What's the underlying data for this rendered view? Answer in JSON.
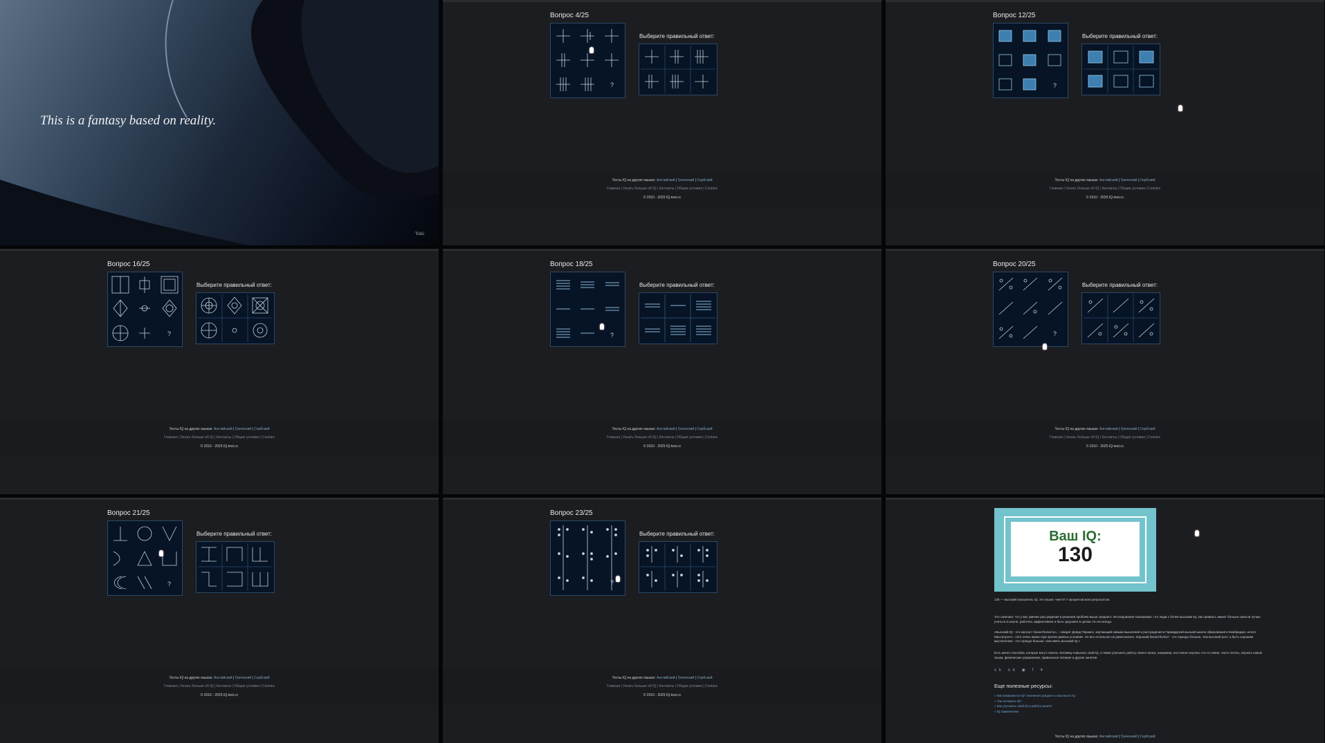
{
  "cover": {
    "quote": "This is a fantasy based on reality.",
    "signature": "Yuki"
  },
  "choose_label": "Выберите правильный ответ:",
  "footer": {
    "languages_prefix": "Тесты IQ на других языках:",
    "languages": [
      "Английский",
      "Греческий",
      "Сербский"
    ],
    "links": [
      "Главная",
      "Узнать больше об IQ",
      "Контакты",
      "Общие условия",
      "Cookies"
    ],
    "copyright": "© 2010 - 2025 IQ-test.cc"
  },
  "questions": [
    {
      "title": "Вопрос 4/25"
    },
    {
      "title": "Вопрос 12/25"
    },
    {
      "title": "Вопрос 16/25"
    },
    {
      "title": "Вопрос 18/25"
    },
    {
      "title": "Вопрос 20/25"
    },
    {
      "title": "Вопрос 21/25"
    },
    {
      "title": "Вопрос 23/25"
    }
  ],
  "result": {
    "label": "Ваш IQ:",
    "value": "130",
    "p1": "130 — высокий показатель IQ. Это выше, чем 97.7 процентов всех результатов.",
    "p2": "Это означает, что у вас умение рассуждения и решения проблем выше среднего. Исследования показывают, что люди с более высоким IQ, как правило, имеют больше шансов лучше учиться в школе, работать эффективнее и быть здоровее в целом. Но не всегда.",
    "p3": "«Высокий IQ - это как рост баскетболиста», - говорит Дэвид Перкинс, изучающий навыки мышления и рассуждения в Гарвардской высшей школе образования в Кембридже, штате Массачусетс. «Это очень важно при прочих равных условиях. Но все остальное не равнозначно. Хороший баскетболист - это гораздо больше, чем высокий рост, а быть хорошим мыслителем - это гораздо больше, чем иметь высокий IQ.»",
    "p4": "Есть много способов, которые могут помочь человеку повысить свой IQ, а также улучшить работу своего мозга, например, постоянно изучать что-то новое, часто читать, изучать новые языки, физические упражнения, правильное питание и другие занятия.",
    "social": "vk ok ◉ f ✈",
    "resources_title": "Еще полезные ресурсы:",
    "resources": [
      "» Как измеряются IQ? Значения среднего и высокого IQ",
      "» Так ли важен IQ?",
      "» Как улучшить свой IQ и работу мозга?",
      "» IQ Заменители"
    ]
  }
}
